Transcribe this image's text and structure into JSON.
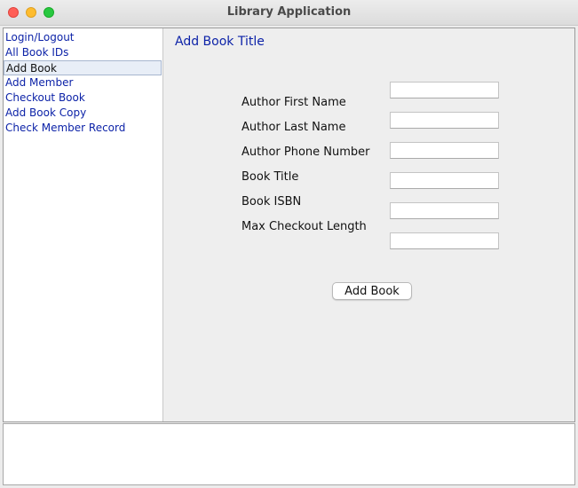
{
  "window": {
    "title": "Library Application"
  },
  "sidebar": {
    "items": [
      {
        "label": "Login/Logout"
      },
      {
        "label": "All Book IDs"
      },
      {
        "label": "Add Book",
        "selected": true
      },
      {
        "label": "Add Member"
      },
      {
        "label": "Checkout Book"
      },
      {
        "label": "Add Book Copy"
      },
      {
        "label": "Check Member Record"
      }
    ]
  },
  "form": {
    "title": "Add Book Title",
    "fields": [
      {
        "label": "Author First Name",
        "value": ""
      },
      {
        "label": "Author Last Name",
        "value": ""
      },
      {
        "label": "Author Phone Number",
        "value": ""
      },
      {
        "label": "Book Title",
        "value": ""
      },
      {
        "label": "Book ISBN",
        "value": ""
      },
      {
        "label": "Max Checkout Length",
        "value": ""
      }
    ],
    "submit_label": "Add Book"
  },
  "colors": {
    "link": "#0d23a8",
    "panel_bg": "#eeeeee",
    "close": "#ff5f57",
    "minimize": "#febc2e",
    "maximize": "#28c840"
  }
}
